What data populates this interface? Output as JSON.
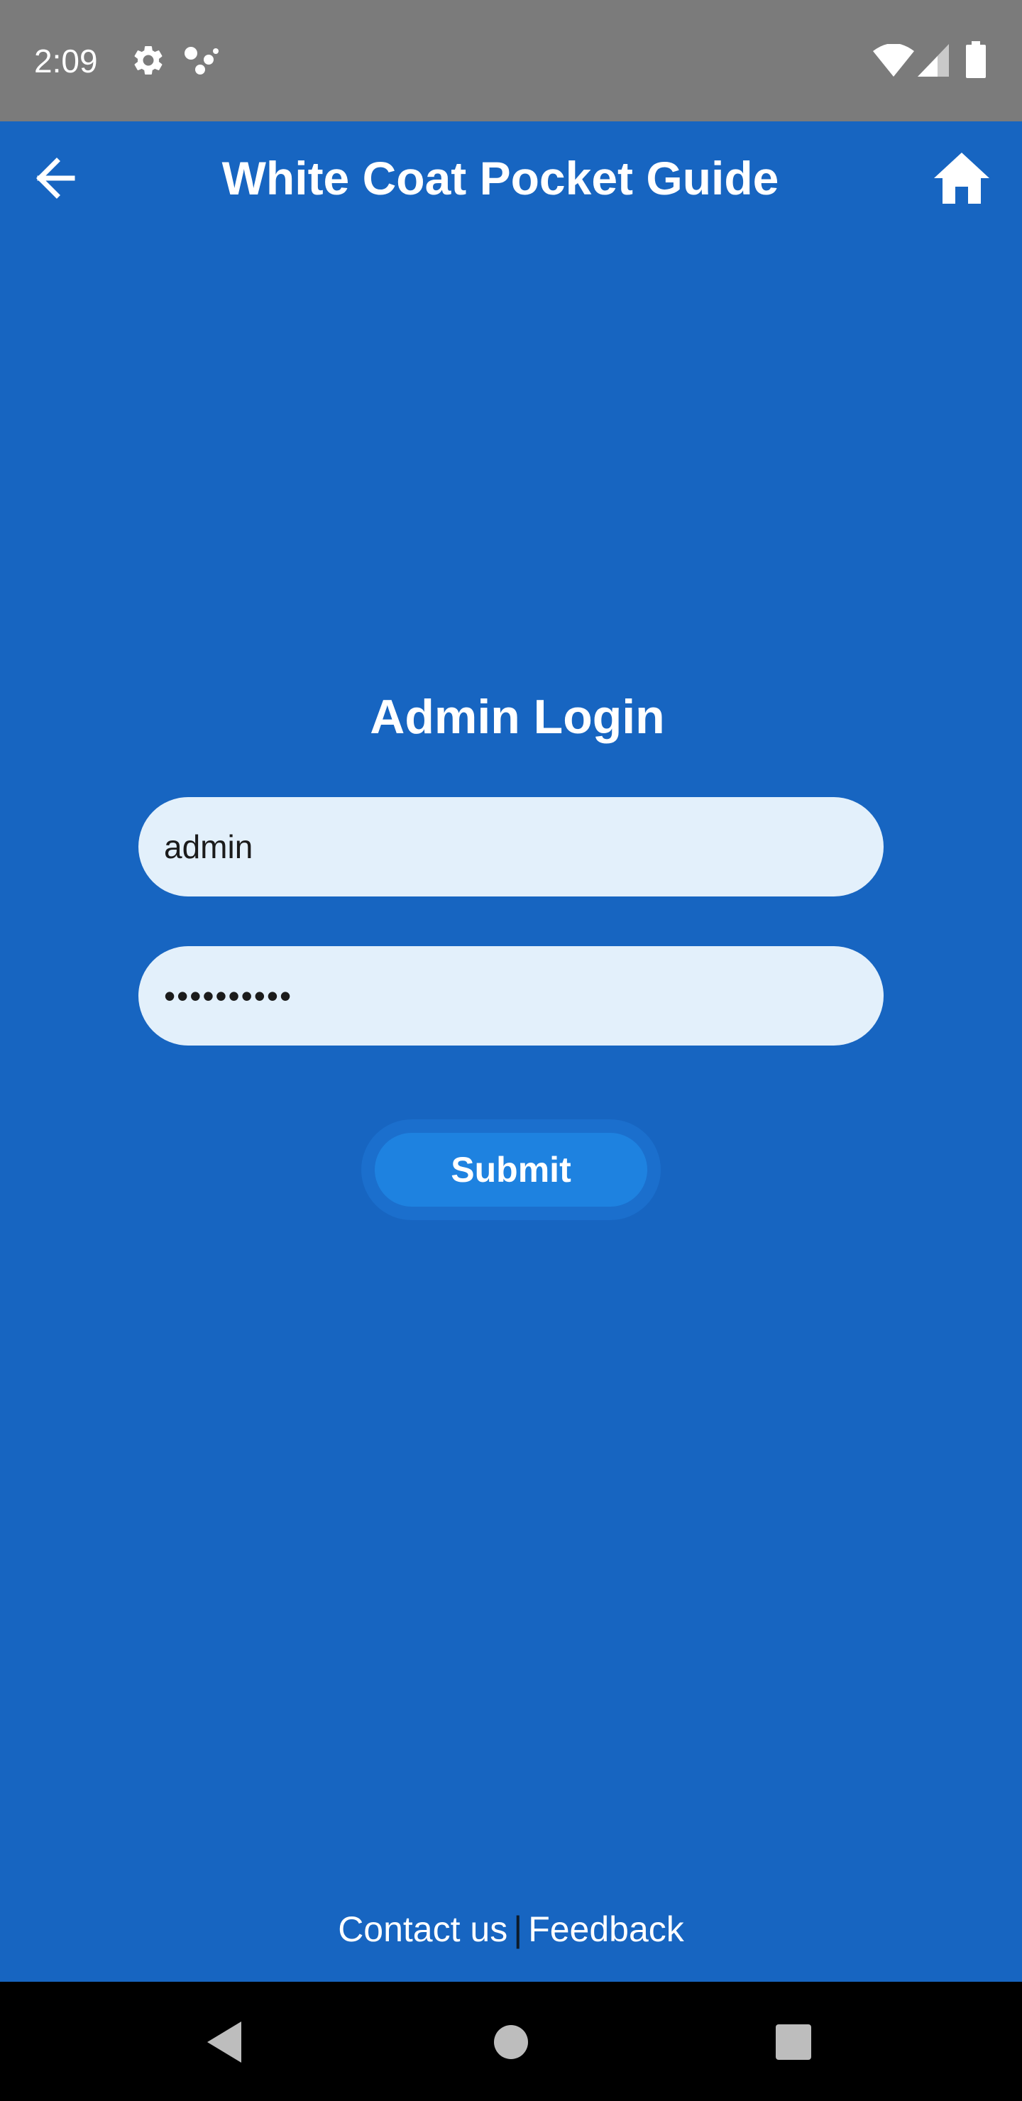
{
  "status_bar": {
    "time": "2:09",
    "icons": [
      "settings-gear-icon",
      "assistant-dots-icon",
      "wifi-icon",
      "cell-signal-icon",
      "battery-icon"
    ]
  },
  "app_bar": {
    "title": "White Coat Pocket Guide",
    "back_icon": "arrow-left-icon",
    "home_icon": "home-icon"
  },
  "login": {
    "title": "Admin Login",
    "username_value": "admin",
    "password_value": "••••••••••",
    "submit_label": "Submit"
  },
  "footer": {
    "contact_label": "Contact us",
    "separator": "|",
    "feedback_label": "Feedback"
  },
  "nav_bar": {
    "icons": [
      "back-triangle-icon",
      "home-circle-icon",
      "recents-square-icon"
    ]
  },
  "colors": {
    "background": "#1765c1",
    "status_bar": "#7b7b7b",
    "field_bg": "#e3f0fb",
    "button": "#1e82e0",
    "nav_bar": "#000000"
  }
}
